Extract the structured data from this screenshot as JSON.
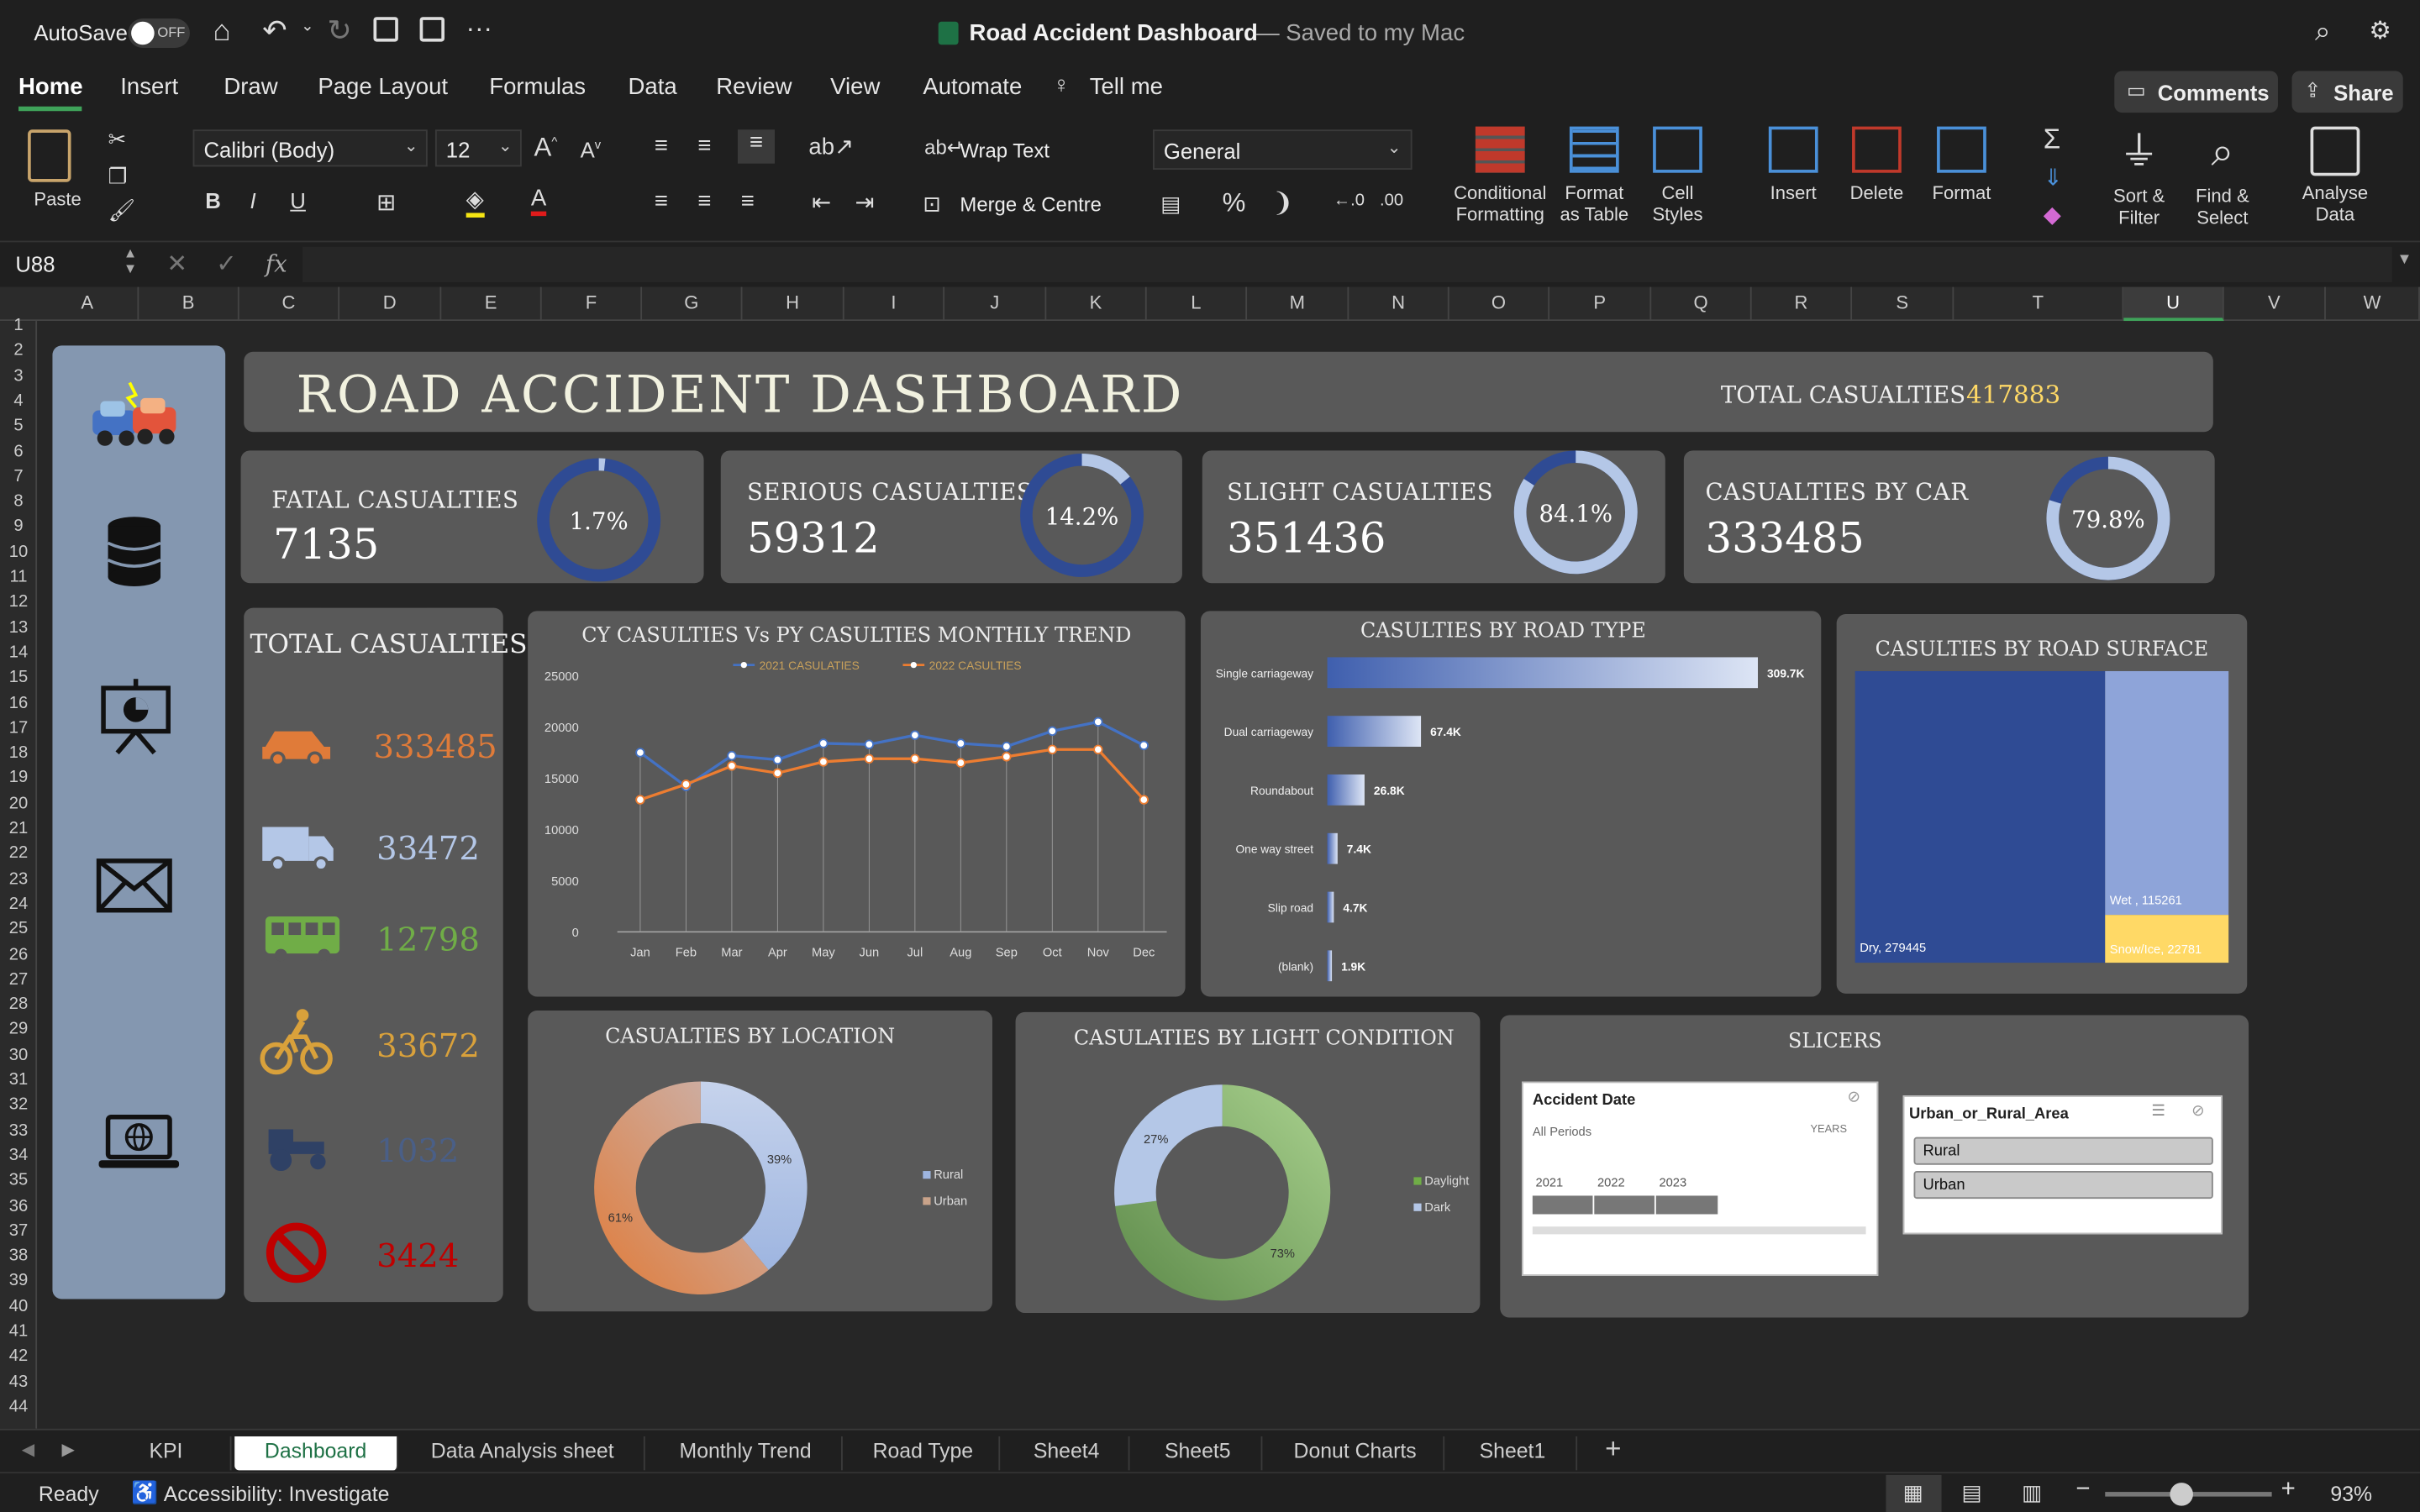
{
  "titlebar": {
    "autosave": "AutoSave",
    "toggle": "OFF",
    "doc_title": "Road Accident Dashboard",
    "saved": "— Saved to my Mac"
  },
  "ribbon": {
    "tabs": [
      "Home",
      "Insert",
      "Draw",
      "Page Layout",
      "Formulas",
      "Data",
      "Review",
      "View",
      "Automate"
    ],
    "tell_me": "Tell me",
    "comments": "Comments",
    "share": "Share",
    "paste": "Paste",
    "font_name": "Calibri (Body)",
    "font_size": "12",
    "wrap_text": "Wrap Text",
    "merge_centre": "Merge & Centre",
    "number_format": "General",
    "conditional_1": "Conditional",
    "conditional_2": "Formatting",
    "format_table_1": "Format",
    "format_table_2": "as Table",
    "cell_styles_1": "Cell",
    "cell_styles_2": "Styles",
    "insert": "Insert",
    "delete": "Delete",
    "format": "Format",
    "sort_1": "Sort &",
    "sort_2": "Filter",
    "find_1": "Find &",
    "find_2": "Select",
    "analyse_1": "Analyse",
    "analyse_2": "Data"
  },
  "formula_bar": {
    "name_box": "U88",
    "fx": "fx",
    "value": ""
  },
  "columns": [
    "A",
    "B",
    "C",
    "D",
    "E",
    "F",
    "G",
    "H",
    "I",
    "J",
    "K",
    "L",
    "M",
    "N",
    "O",
    "P",
    "Q",
    "R",
    "S",
    "T",
    "U",
    "V",
    "W"
  ],
  "rows": [
    "1",
    "2",
    "3",
    "4",
    "5",
    "6",
    "7",
    "8",
    "9",
    "10",
    "11",
    "12",
    "13",
    "14",
    "15",
    "16",
    "17",
    "18",
    "19",
    "20",
    "21",
    "22",
    "23",
    "24",
    "25",
    "26",
    "27",
    "28",
    "29",
    "30",
    "31",
    "32",
    "33",
    "34",
    "35",
    "36",
    "37",
    "38",
    "39",
    "40",
    "41",
    "42",
    "43",
    "44"
  ],
  "dashboard": {
    "title": "ROAD ACCIDENT DASHBOARD",
    "total_label": "TOTAL CASUALTIES",
    "total_value": "417883",
    "kpis": [
      {
        "label": "FATAL CASUALTIES",
        "value": "7135",
        "pct": "1.7%",
        "fraction": 0.017
      },
      {
        "label": "SERIOUS CASUALTIES",
        "value": "59312",
        "pct": "14.2%",
        "fraction": 0.142
      },
      {
        "label": "SLIGHT CASUALTIES",
        "value": "351436",
        "pct": "84.1%",
        "fraction": 0.841
      },
      {
        "label": "CASUALTIES BY CAR",
        "value": "333485",
        "pct": "79.8%",
        "fraction": 0.798
      }
    ],
    "vehicle_panel": {
      "title": "TOTAL CASUALTIES",
      "items": [
        {
          "icon": "car-icon",
          "value": "333485",
          "color": "#e07b39"
        },
        {
          "icon": "van-icon",
          "value": "33472",
          "color": "#b4c7e7"
        },
        {
          "icon": "bus-icon",
          "value": "12798",
          "color": "#70ad47"
        },
        {
          "icon": "bicycle-icon",
          "value": "33672",
          "color": "#d9a13b"
        },
        {
          "icon": "agricultural-vehicle-icon",
          "value": "1032",
          "color": "#4a5f87"
        },
        {
          "icon": "no-entry-icon",
          "value": "3424",
          "color": "#c00000"
        }
      ]
    },
    "slicers": {
      "title": "SLICERS",
      "date_title": "Accident  Date",
      "all_periods": "All Periods",
      "years": "YEARS",
      "year_labels": [
        "2021",
        "2022",
        "2023"
      ],
      "area_title": "Urban_or_Rural_Area",
      "area_items": [
        "Rural",
        "Urban"
      ]
    }
  },
  "chart_data": [
    {
      "type": "line",
      "title": "CY CASULTIES Vs PY CASULTIES MONTHLY TREND",
      "x": [
        "Jan",
        "Feb",
        "Mar",
        "Apr",
        "May",
        "Jun",
        "Jul",
        "Aug",
        "Sep",
        "Oct",
        "Nov",
        "Dec"
      ],
      "ylim": [
        0,
        25000
      ],
      "yticks": [
        "0",
        "5000",
        "10000",
        "15000",
        "20000",
        "25000"
      ],
      "series": [
        {
          "name": "2021 CASULATIES",
          "color": "#4472c4",
          "values": [
            17500,
            14200,
            17200,
            16800,
            18400,
            18300,
            19200,
            18400,
            18100,
            19600,
            20500,
            18200
          ]
        },
        {
          "name": "2022 CASULTIES",
          "color": "#ed7d31",
          "values": [
            12900,
            14400,
            16200,
            15500,
            16600,
            16900,
            16900,
            16500,
            17100,
            17800,
            17800,
            12900
          ]
        }
      ]
    },
    {
      "type": "bar",
      "title": "CASULTIES BY ROAD TYPE",
      "categories": [
        "Single carriageway",
        "Dual carriageway",
        "Roundabout",
        "One way street",
        "Slip road",
        "(blank)"
      ],
      "values": [
        309.7,
        67.4,
        26.8,
        7.4,
        4.7,
        1.9
      ],
      "labels": [
        "309.7K",
        "67.4K",
        "26.8K",
        "7.4K",
        "4.7K",
        "1.9K"
      ]
    },
    {
      "type": "heatmap",
      "title": "CASULTIES BY ROAD SURFACE",
      "categories": [
        "Dry",
        "Wet",
        "Snow/Ice"
      ],
      "values": [
        279445,
        115261,
        22781
      ],
      "labels": [
        "Dry, 279445",
        "Wet , 115261",
        "Snow/Ice, 22781"
      ]
    },
    {
      "type": "pie",
      "title": "CASUALTIES BY LOCATION",
      "categories": [
        "Rural",
        "Urban"
      ],
      "values": [
        39,
        61
      ],
      "labels": [
        "39%",
        "61%"
      ]
    },
    {
      "type": "pie",
      "title": "CASULATIES BY LIGHT CONDITION",
      "categories": [
        "Daylight",
        "Dark"
      ],
      "values": [
        73,
        27
      ],
      "labels": [
        "73%",
        "27%"
      ]
    }
  ],
  "sheet_tabs": [
    "KPI",
    "Dashboard",
    "Data Analysis sheet",
    "Monthly Trend",
    "Road Type",
    "Sheet4",
    "Sheet5",
    "Donut Charts",
    "Sheet1"
  ],
  "statusbar": {
    "ready": "Ready",
    "accessibility": "Accessibility: Investigate",
    "zoom": "93%"
  }
}
